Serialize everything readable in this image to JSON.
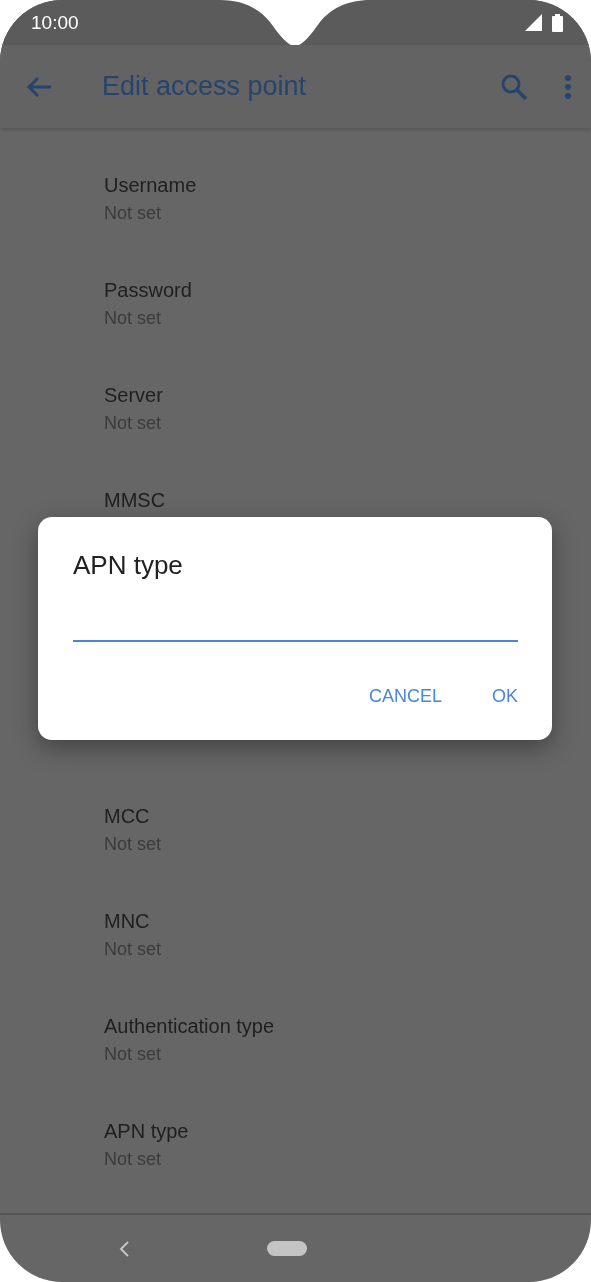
{
  "status_bar": {
    "time": "10:00"
  },
  "app_bar": {
    "title": "Edit access point"
  },
  "items_top": [
    {
      "title": "Username",
      "value": "Not set"
    },
    {
      "title": "Password",
      "value": "Not set"
    },
    {
      "title": "Server",
      "value": "Not set"
    },
    {
      "title": "MMSC"
    }
  ],
  "items_bottom": [
    {
      "title": "MCC",
      "value": "Not set"
    },
    {
      "title": "MNC",
      "value": "Not set"
    },
    {
      "title": "Authentication type",
      "value": "Not set"
    },
    {
      "title": "APN type",
      "value": "Not set"
    }
  ],
  "dialog": {
    "title": "APN type",
    "buttons": [
      "CANCEL",
      "OK"
    ]
  }
}
